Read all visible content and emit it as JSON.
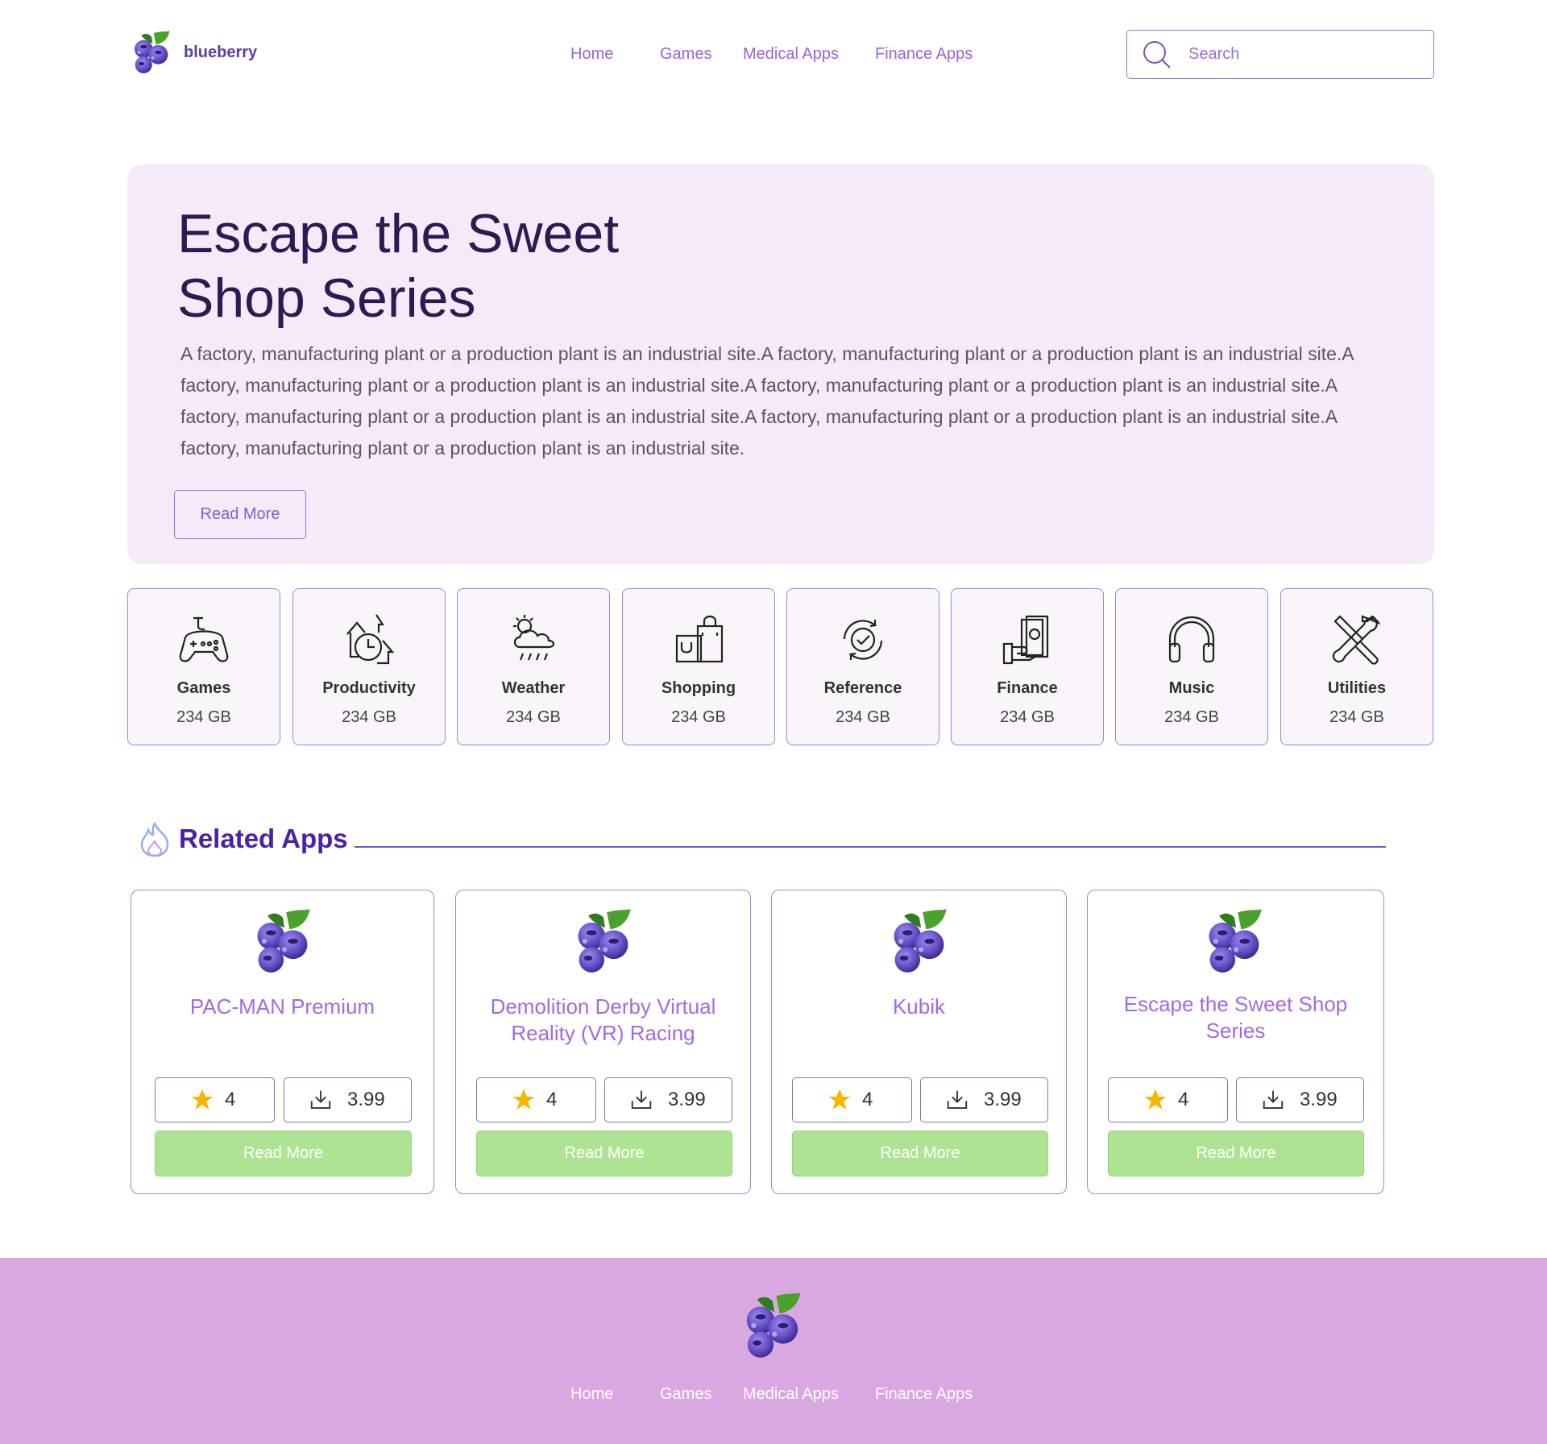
{
  "brand": {
    "name": "blueberry",
    "logo_icon": "blueberry-icon"
  },
  "nav": {
    "items": [
      "Home",
      "Games",
      "Medical Apps",
      "Finance Apps"
    ]
  },
  "search": {
    "placeholder": "Search"
  },
  "hero": {
    "title_line1": "Escape the Sweet",
    "title_line2": "Shop Series",
    "description": "A factory, manufacturing plant or a production plant is an industrial site.A factory, manufacturing plant or a production plant is an industrial site.A factory, manufacturing plant or a production plant is an industrial site.A factory, manufacturing plant or a production plant is an industrial site.A factory, manufacturing plant or a production plant is an industrial site.A factory, manufacturing plant or a production plant is an industrial site.A factory, manufacturing plant or a production plant is an industrial site.",
    "button": "Read More"
  },
  "categories": [
    {
      "name": "Games",
      "size": "234 GB",
      "icon": "gamepad-icon"
    },
    {
      "name": "Productivity",
      "size": "234 GB",
      "icon": "productivity-icon"
    },
    {
      "name": "Weather",
      "size": "234 GB",
      "icon": "weather-icon"
    },
    {
      "name": "Shopping",
      "size": "234 GB",
      "icon": "shopping-bag-icon"
    },
    {
      "name": "Reference",
      "size": "234 GB",
      "icon": "refresh-check-icon"
    },
    {
      "name": "Finance",
      "size": "234 GB",
      "icon": "money-hand-icon"
    },
    {
      "name": "Music",
      "size": "234 GB",
      "icon": "headphones-icon"
    },
    {
      "name": "Utilities",
      "size": "234 GB",
      "icon": "tools-icon"
    }
  ],
  "related": {
    "title": "Related Apps",
    "icon": "flame-icon",
    "apps": [
      {
        "title": "PAC-MAN Premium",
        "rating": "4",
        "price": "3.99",
        "button": "Read More"
      },
      {
        "title": "Demolition Derby Virtual Reality (VR) Racing",
        "rating": "4",
        "price": "3.99",
        "button": "Read More"
      },
      {
        "title": "Kubik",
        "rating": "4",
        "price": "3.99",
        "button": "Read More"
      },
      {
        "title": "Escape the Sweet Shop Series",
        "rating": "4",
        "price": "3.99",
        "button": "Read More"
      }
    ]
  },
  "footer": {
    "nav": [
      "Home",
      "Games",
      "Medical Apps",
      "Finance Apps"
    ]
  },
  "colors": {
    "accent": "#9a62d9",
    "hero_bg": "#f5eaf8",
    "button_green": "#aee394",
    "footer_bg": "#daa8e1",
    "heading": "#4a21a8"
  }
}
